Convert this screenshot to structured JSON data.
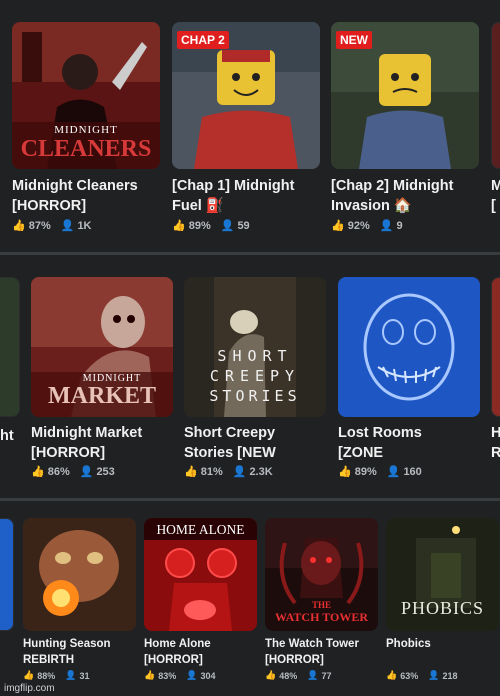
{
  "row1": {
    "cards": [
      {
        "title1": "Midnight Cleaners",
        "title2": "[HORROR]",
        "like": "87%",
        "players": "1K",
        "thumb_text1": "MIDNIGHT",
        "thumb_text2": "CLEANERS"
      },
      {
        "title1": "[Chap 1] Midnight",
        "title2": "Fuel ⛽",
        "like": "89%",
        "players": "59",
        "badge": "CHAP 2"
      },
      {
        "title1": "[Chap 2] Midnight",
        "title2": "Invasion 🏠",
        "like": "92%",
        "players": "9",
        "badge": "NEW"
      },
      {
        "title1": "M",
        "title2": "[",
        "like": "",
        "players": ""
      }
    ]
  },
  "row2": {
    "cards": [
      {
        "title1": "ht",
        "title2": "",
        "like": "",
        "players": ""
      },
      {
        "title1": "Midnight Market",
        "title2": "[HORROR]",
        "like": "86%",
        "players": "253",
        "thumb_text1": "MIDNIGHT",
        "thumb_text2": "MARKET"
      },
      {
        "title1": "Short Creepy",
        "title2": "Stories [NEW",
        "like": "81%",
        "players": "2.3K",
        "thumb_text1": "SHORT",
        "thumb_text2": "CREEPY",
        "thumb_text3": "STORIES"
      },
      {
        "title1": "Lost Rooms",
        "title2": "[ZONE",
        "like": "89%",
        "players": "160"
      },
      {
        "title1": "H",
        "title2": "R",
        "like": "",
        "players": ""
      }
    ]
  },
  "row3": {
    "cards": [
      {
        "title1": "Hunting Season",
        "title2": "REBIRTH",
        "like": "88%",
        "players": "31"
      },
      {
        "title1": "Home Alone",
        "title2": "[HORROR]",
        "like": "83%",
        "players": "304",
        "thumb_text1": "HOME ALONE"
      },
      {
        "title1": "The Watch Tower",
        "title2": "[HORROR]",
        "like": "48%",
        "players": "77",
        "thumb_text1": "THE",
        "thumb_text2": "WATCH TOWER"
      },
      {
        "title1": "Phobics",
        "title2": "",
        "like": "63%",
        "players": "218",
        "thumb_text1": "PHOBICS"
      }
    ]
  },
  "footer": "imgflip.com",
  "colors": {
    "background": "#232527",
    "badge": "#e01e1e",
    "stat_text": "#b8bcc0"
  }
}
